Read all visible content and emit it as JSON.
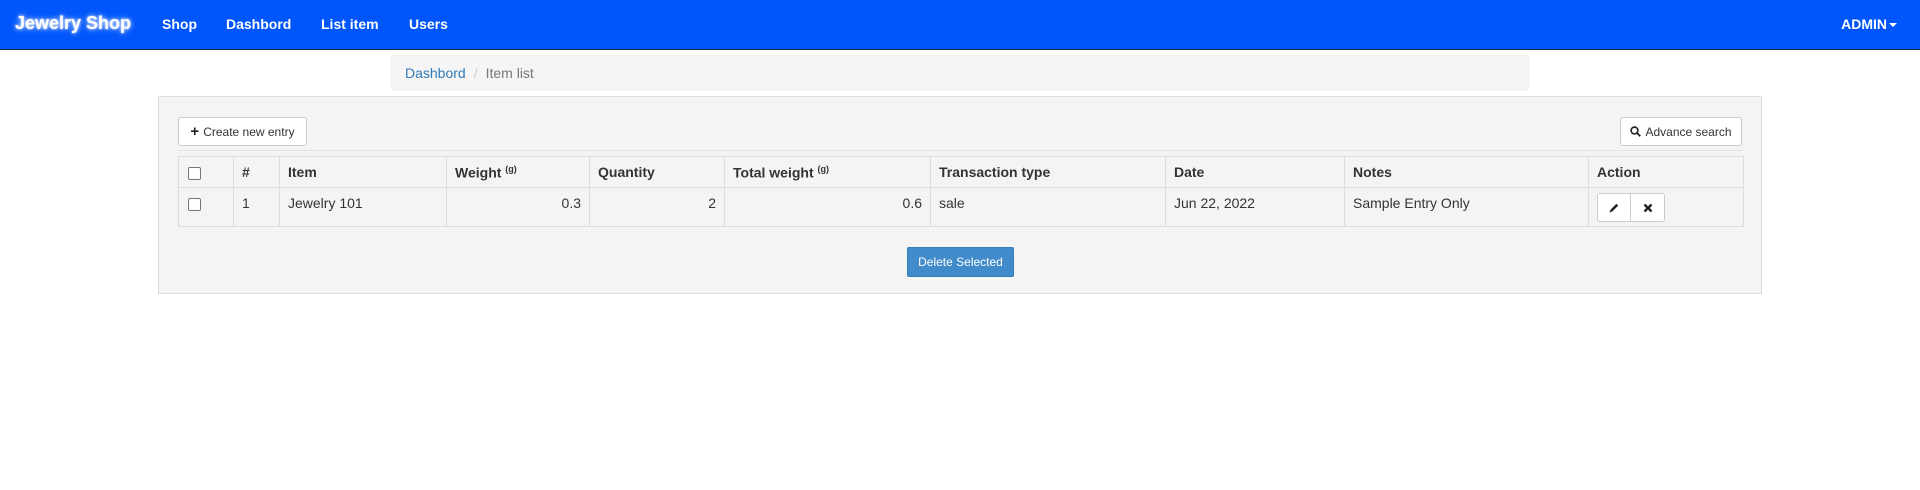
{
  "navbar": {
    "brand": "Jewelry Shop",
    "links": [
      "Shop",
      "Dashbord",
      "List item",
      "Users"
    ],
    "user_label": "ADMIN"
  },
  "breadcrumb": {
    "link": "Dashbord",
    "separator": "/",
    "active": "Item list"
  },
  "toolbar": {
    "create_label": "Create new entry",
    "search_label": "Advance search"
  },
  "table": {
    "headers": {
      "index": "#",
      "item": "Item",
      "weight": "Weight",
      "weight_unit": "(g)",
      "quantity": "Quantity",
      "total_weight": "Total weight",
      "total_weight_unit": "(g)",
      "transaction_type": "Transaction type",
      "date": "Date",
      "notes": "Notes",
      "action": "Action"
    },
    "rows": [
      {
        "index": "1",
        "item": "Jewelry 101",
        "weight": "0.3",
        "quantity": "2",
        "total_weight": "0.6",
        "transaction_type": "sale",
        "date": "Jun 22, 2022",
        "notes": "Sample Entry Only"
      }
    ]
  },
  "footer": {
    "delete_label": "Delete Selected"
  },
  "colors": {
    "navbar_bg": "#0056fb",
    "primary_button": "#428bca",
    "link": "#337ab7"
  },
  "icons": [
    "plus-icon",
    "search-icon",
    "pencil-icon",
    "times-icon",
    "caret-down-icon"
  ]
}
